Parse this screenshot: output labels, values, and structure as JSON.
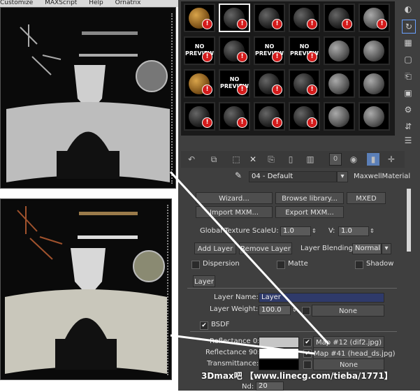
{
  "menu": {
    "items": [
      "Customize",
      "MAXScript",
      "Help",
      "Ornatrix"
    ]
  },
  "material_editor": {
    "slots": [
      [
        "orange",
        "dark",
        "dark",
        "dark",
        "dark",
        "grey"
      ],
      [
        "nopreview",
        "dark",
        "nopreview",
        "nopreview",
        "grey",
        "grey"
      ],
      [
        "orange",
        "nopreview",
        "dark",
        "dark",
        "grey",
        "grey"
      ],
      [
        "dark",
        "dark",
        "dark",
        "dark",
        "grey",
        "grey"
      ]
    ],
    "no_preview_text": "NO PREVIEW",
    "slot_count_field": "0",
    "material_name": "04 - Default",
    "material_type": "MaxwellMaterial"
  },
  "maxwell": {
    "wizard_label": "Wizard...",
    "browse_library_label": "Browse library...",
    "mxed_label": "MXED",
    "import_mxm_label": "Import MXM...",
    "export_mxm_label": "Export MXM...",
    "global_texture_scale_label": "Global Texture Scale",
    "u_label": "U:",
    "u_value": "1.0",
    "v_label": "V:",
    "v_value": "1.0",
    "add_layer_label": "Add Layer",
    "remove_layer_label": "Remove Layer",
    "layer_blending_label": "Layer Blending:",
    "layer_blending_value": "Normal",
    "dispersion_label": "Dispersion",
    "matte_label": "Matte",
    "shadow_label": "Shadow",
    "layer_tab_label": "Layer",
    "layer_name_label": "Layer Name:",
    "layer_name_value": "Layer",
    "layer_weight_label": "Layer Weight:",
    "layer_weight_value": "100.0",
    "none_label": "None",
    "bsdf_label": "BSDF",
    "reflectance0_label": "Reflectance 0:",
    "reflectance0_map": "Map #12 (dif2.jpg)",
    "reflectance90_label": "Reflectance 90:",
    "reflectance90_map": "Map #41 (head_ds.jpg)",
    "transmittance_label": "Transmittance:",
    "transmittance_map": "None",
    "nd_label": "Nd:",
    "nd_value": "20"
  },
  "watermark": "3Dmax吧 【www.linecg.com/tieba/1771】"
}
